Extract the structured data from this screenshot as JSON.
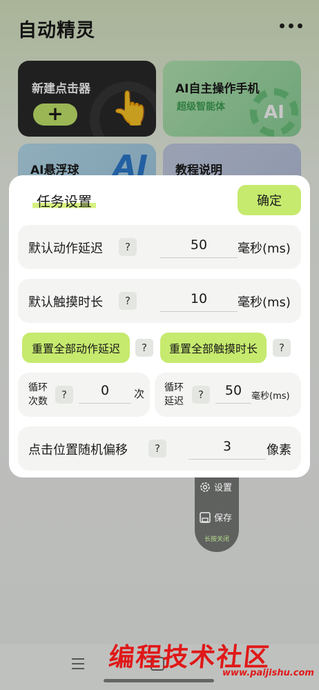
{
  "app": {
    "title": "自动精灵"
  },
  "cards": {
    "new_clicker": "新建点击器",
    "new_clicker_button": "+",
    "ai_agent": "AI自主操作手机",
    "ai_agent_sub": "超级智能体",
    "ai_agent_badge": "AI",
    "ai_float": "AI悬浮球",
    "ai_float_badge": "AI",
    "tutorial": "教程说明"
  },
  "dialog": {
    "title": "任务设置",
    "confirm": "确定",
    "help_glyph": "?",
    "action_delay": {
      "label": "默认动作延迟",
      "value": "50",
      "unit": "毫秒(ms)"
    },
    "touch_duration": {
      "label": "默认触摸时长",
      "value": "10",
      "unit": "毫秒(ms)"
    },
    "reset_action_delay": "重置全部动作延迟",
    "reset_touch_duration": "重置全部触摸时长",
    "loop_count": {
      "label_line1": "循环",
      "label_line2": "次数",
      "value": "0",
      "unit": "次"
    },
    "loop_delay": {
      "label_line1": "循环",
      "label_line2": "延迟",
      "value": "50",
      "unit": "毫秒(ms)"
    },
    "random_offset": {
      "label": "点击位置随机偏移",
      "value": "3",
      "unit": "像素"
    }
  },
  "float_menu": {
    "settings": "设置",
    "save": "保存",
    "hint": "长按关闭"
  },
  "watermark": {
    "text": "编程技术社区",
    "url": "www.paijishu.com"
  },
  "colors": {
    "accent": "#c6ea6e",
    "dialog_bg": "#ffffff",
    "row_bg": "#f4f5f3",
    "watermark": "#e01818"
  }
}
